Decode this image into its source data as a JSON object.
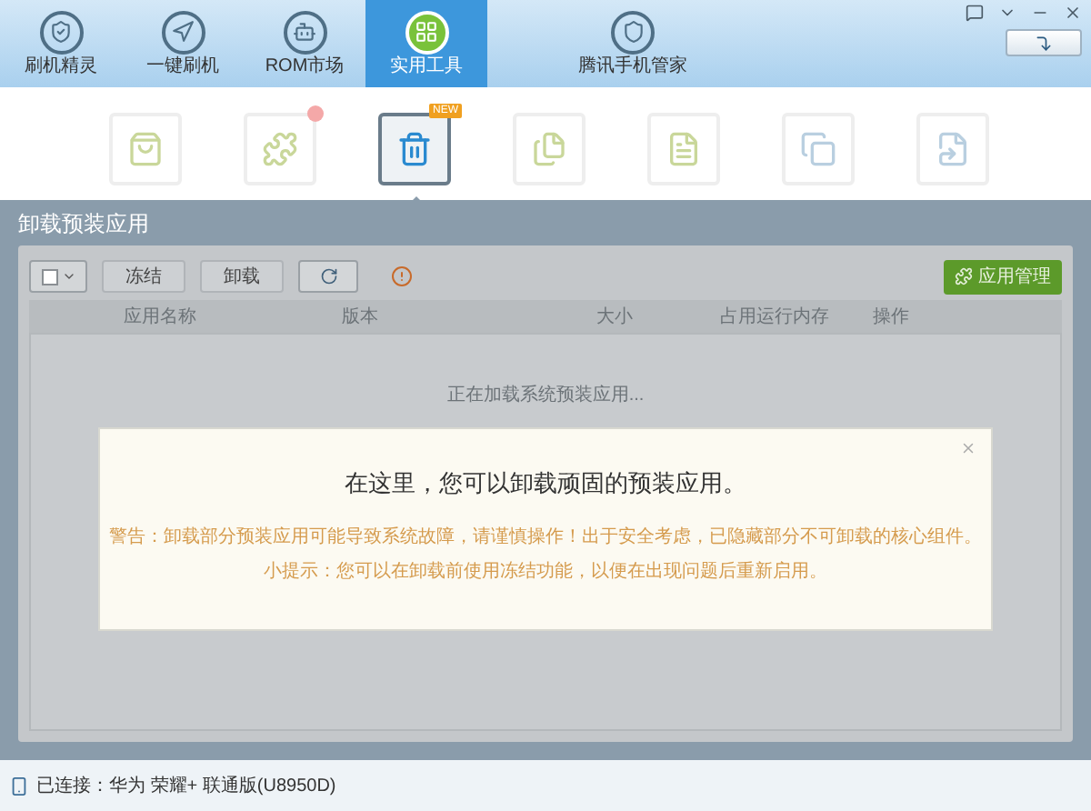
{
  "nav_tabs": [
    {
      "label": "刷机精灵",
      "selected": false,
      "kind": "shield"
    },
    {
      "label": "一键刷机",
      "selected": false,
      "kind": "cursor"
    },
    {
      "label": "ROM市场",
      "selected": false,
      "kind": "robot"
    },
    {
      "label": "实用工具",
      "selected": true,
      "kind": "grid"
    },
    {
      "label": "腾讯手机管家",
      "selected": false,
      "kind": "guard"
    }
  ],
  "tools": [
    {
      "kind": "bag",
      "selected": false,
      "notification": false
    },
    {
      "kind": "puzzle",
      "selected": false,
      "notification": true
    },
    {
      "kind": "trash",
      "selected": true,
      "notification": false,
      "badge": "NEW"
    },
    {
      "kind": "files",
      "selected": false,
      "notification": false
    },
    {
      "kind": "doc",
      "selected": false,
      "notification": false
    },
    {
      "kind": "copy",
      "selected": false,
      "notification": false
    },
    {
      "kind": "export",
      "selected": false,
      "notification": false
    }
  ],
  "section_title": "卸载预装应用",
  "toolbar": {
    "select_all": {
      "checked": false
    },
    "buttons": [
      "冻结",
      "卸载"
    ],
    "manage_button": "应用管理"
  },
  "table": {
    "columns": [
      "应用名称",
      "版本",
      "大小",
      "占用运行内存",
      "操作"
    ],
    "loading": "正在加载系统预装应用..."
  },
  "dialog": {
    "heading": "在这里，您可以卸载顽固的预装应用。",
    "warning": "警告：卸载部分预装应用可能导致系统故障，请谨慎操作！出于安全考虑，已隐藏部分不可卸载的核心组件。",
    "tip": "小提示：您可以在卸载前使用冻结功能，以便在出现问题后重新启用。"
  },
  "status_bar": "已连接：华为 荣耀+ 联通版(U8950D)"
}
